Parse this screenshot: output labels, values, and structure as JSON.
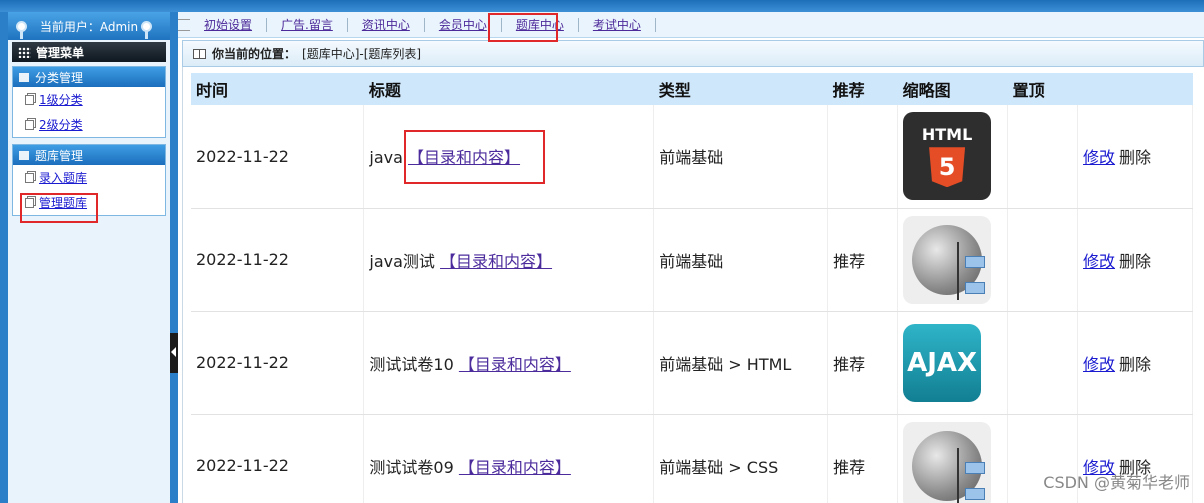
{
  "user_bar": "当前用户：Admin",
  "menu_title": "管理菜单",
  "groups": [
    {
      "title": "分类管理",
      "items": [
        "1级分类",
        "2级分类"
      ]
    },
    {
      "title": "题库管理",
      "items": [
        "录入题库",
        "管理题库"
      ]
    }
  ],
  "nav": [
    "初始设置",
    "广告.留言",
    "资讯中心",
    "会员中心",
    "题库中心",
    "考试中心"
  ],
  "breadcrumb": {
    "label": "你当前的位置：",
    "path": "[题库中心]-[题库列表]"
  },
  "table": {
    "headers": [
      "时间",
      "标题",
      "类型",
      "推荐",
      "缩略图",
      "置顶",
      ""
    ],
    "rows": [
      {
        "time": "2022-11-22",
        "title": "java",
        "link": "【目录和内容】",
        "type": "前端基础",
        "recommend": "",
        "thumb": "html5",
        "edit": "修改",
        "del": "删除"
      },
      {
        "time": "2022-11-22",
        "title": "java测试",
        "link": "【目录和内容】",
        "type": "前端基础",
        "recommend": "推荐",
        "thumb": "globe",
        "edit": "修改",
        "del": "删除"
      },
      {
        "time": "2022-11-22",
        "title": "测试试卷10",
        "link": "【目录和内容】",
        "type": "前端基础 > HTML",
        "recommend": "推荐",
        "thumb": "ajax",
        "edit": "修改",
        "del": "删除"
      },
      {
        "time": "2022-11-22",
        "title": "测试试卷09",
        "link": "【目录和内容】",
        "type": "前端基础 > CSS",
        "recommend": "推荐",
        "thumb": "globe",
        "edit": "修改",
        "del": "删除"
      }
    ]
  },
  "thumbs": {
    "html5_label": "HTML",
    "html5_number": "5",
    "ajax_label": "AJAX"
  },
  "watermark": "CSDN @黄菊华老师",
  "colors": {
    "accent": "#2a7fc8",
    "header": "#cfe7fb",
    "highlight": "#e0282b"
  }
}
